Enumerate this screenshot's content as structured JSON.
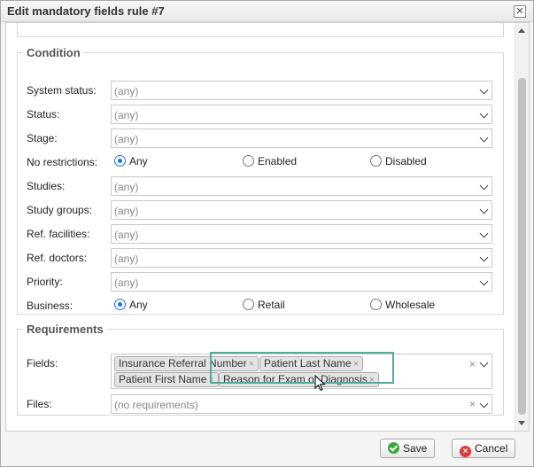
{
  "dialog": {
    "title": "Edit mandatory fields rule #7",
    "close_glyph": "✕"
  },
  "condition": {
    "legend": "Condition",
    "rows": [
      {
        "label": "System status:",
        "value": "(any)"
      },
      {
        "label": "Status:",
        "value": "(any)"
      },
      {
        "label": "Stage:",
        "value": "(any)"
      }
    ],
    "no_restrictions": {
      "label": "No restrictions:",
      "options": [
        "Any",
        "Enabled",
        "Disabled"
      ],
      "selected": "Any"
    },
    "rows2": [
      {
        "label": "Studies:",
        "value": "(any)"
      },
      {
        "label": "Study groups:",
        "value": "(any)"
      },
      {
        "label": "Ref. facilities:",
        "value": "(any)"
      },
      {
        "label": "Ref. doctors:",
        "value": "(any)"
      },
      {
        "label": "Priority:",
        "value": "(any)"
      }
    ],
    "business": {
      "label": "Business:",
      "options": [
        "Any",
        "Retail",
        "Wholesale"
      ],
      "selected": "Any"
    }
  },
  "requirements": {
    "legend": "Requirements",
    "fields": {
      "label": "Fields:",
      "tags": [
        "Insurance Referral Number",
        "Patient Last Name",
        "Patient First Name",
        "Reason for Exam or Diagnosis"
      ],
      "tag_remove_glyph": "×",
      "clear_glyph": "×"
    },
    "files": {
      "label": "Files:",
      "placeholder": "(no requirements)",
      "clear_glyph": "×"
    }
  },
  "footer": {
    "save_label": "Save",
    "cancel_label": "Cancel",
    "cancel_glyph": "×"
  },
  "icons": {
    "save": "check-circle-icon",
    "cancel": "x-circle-icon",
    "cursor": "mouse-pointer-icon"
  },
  "colors": {
    "radio_accent": "#1a73e8",
    "highlight": "#5aa89a"
  }
}
